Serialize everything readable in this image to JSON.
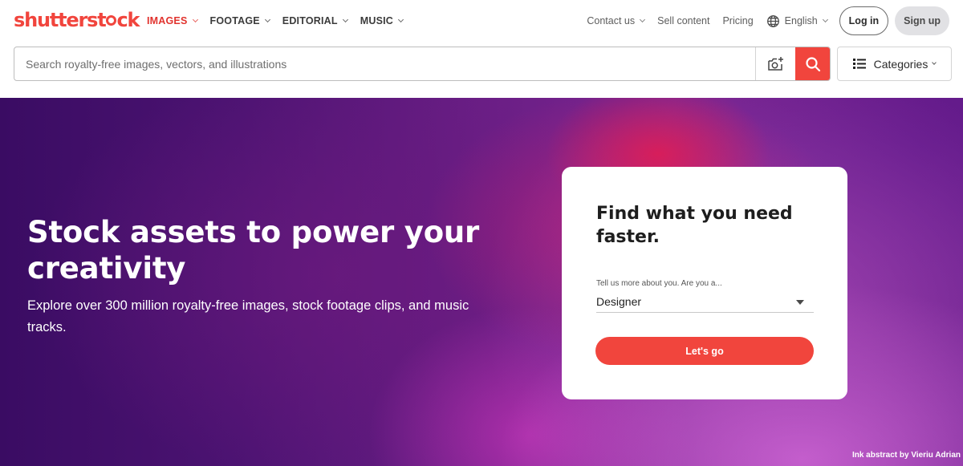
{
  "brand": {
    "logo_before": "shutterst",
    "logo_after": "ck",
    "accent_color": "#f1453d"
  },
  "nav": {
    "items": [
      {
        "label": "IMAGES",
        "active": true
      },
      {
        "label": "FOOTAGE",
        "active": false
      },
      {
        "label": "EDITORIAL",
        "active": false
      },
      {
        "label": "MUSIC",
        "active": false
      }
    ],
    "contact": "Contact us",
    "sell": "Sell content",
    "pricing": "Pricing",
    "language": "English",
    "login": "Log in",
    "signup": "Sign up"
  },
  "search": {
    "placeholder": "Search royalty-free images, vectors, and illustrations",
    "value": "",
    "camera_icon": "camera-search-icon",
    "search_icon": "search-icon",
    "categories_label": "Categories"
  },
  "hero": {
    "headline": "Stock assets to power your creativity",
    "subtext": "Explore over 300 million royalty-free images, stock footage clips, and music tracks.",
    "credit": "Ink abstract by Vieriu Adrian"
  },
  "card": {
    "title": "Find what you need faster.",
    "label": "Tell us more about you. Are you a...",
    "selected": "Designer",
    "button": "Let's go"
  }
}
